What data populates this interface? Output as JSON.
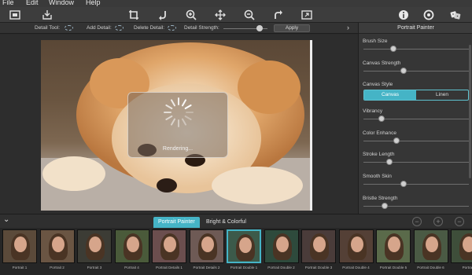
{
  "menu": [
    "File",
    "Edit",
    "Window",
    "Help"
  ],
  "toolbar": {
    "left": [
      "image-open-icon",
      "save-export-icon"
    ],
    "center": [
      "crop-icon",
      "rotate-left-icon",
      "zoom-in-icon",
      "pan-move-icon",
      "zoom-out-icon",
      "rotate-right-icon",
      "fit-screen-icon"
    ],
    "right": [
      "info-icon",
      "settings-icon",
      "dice-random-icon"
    ]
  },
  "options": {
    "detail_tool": "Detail Tool:",
    "add_detail": "Add Detail:",
    "delete_detail": "Delete Detail:",
    "detail_strength": "Detail Strength:",
    "detail_strength_value": 0.82,
    "apply": "Apply"
  },
  "overlay": {
    "text": "Rendering..."
  },
  "panel": {
    "title": "Portrait Painter",
    "controls": [
      {
        "label": "Brush Size",
        "value": 0.27
      },
      {
        "label": "Canvas Strength",
        "value": 0.37
      },
      {
        "label": "Vibrancy",
        "value": 0.15
      },
      {
        "label": "Color Enhance",
        "value": 0.3
      },
      {
        "label": "Stroke Length",
        "value": 0.23
      },
      {
        "label": "Smooth Skin",
        "value": 0.37
      },
      {
        "label": "Bristle Strength",
        "value": 0.18
      }
    ],
    "canvas_style_label": "Canvas Style",
    "canvas_style_options": [
      "Canvas",
      "Linen"
    ],
    "canvas_style_selected": "Canvas"
  },
  "filmstrip": {
    "tabs": [
      "Portrait Painter",
      "Bright & Colorful"
    ],
    "active_tab": "Portrait Painter",
    "buttons": [
      "minus-circle-icon",
      "plus-circle-icon",
      "minus-circle-icon"
    ],
    "thumbs": [
      "Portrait 1",
      "Portrait 2",
      "Portrait 3",
      "Portrait 4",
      "Portrait Details 1",
      "Portrait Details 2",
      "Portrait Double 1",
      "Portrait Double 2",
      "Portrait Double 3",
      "Portrait Double 4",
      "Portrait Double 5",
      "Portrait Double 6",
      "Portrait"
    ],
    "selected_thumb": "Portrait Double 1"
  },
  "colors": {
    "accent": "#45b4c6",
    "panel": "#363636",
    "background": "#2b2b2b"
  }
}
